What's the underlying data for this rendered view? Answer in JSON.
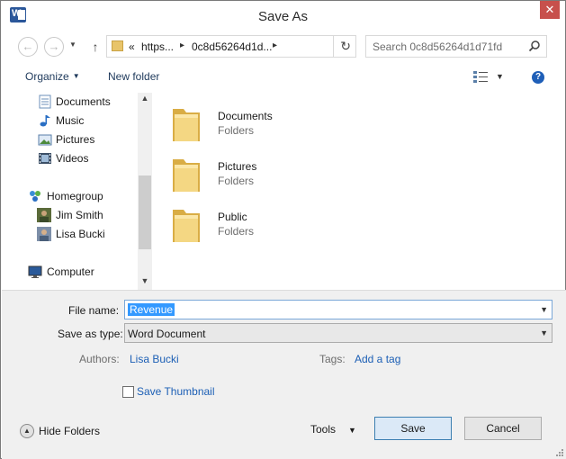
{
  "window": {
    "title": "Save As",
    "app_icon": "word-icon",
    "close_label": "✕"
  },
  "address_bar": {
    "back_icon": "back-arrow-icon",
    "forward_icon": "forward-arrow-icon",
    "up_icon": "up-arrow-icon",
    "overflow": "«",
    "segments": [
      "https...",
      "0c8d56264d1d..."
    ],
    "refresh_icon": "refresh-icon"
  },
  "search": {
    "placeholder": "Search 0c8d56264d1d71fd"
  },
  "toolbar": {
    "organize_label": "Organize",
    "new_folder_label": "New folder",
    "view_icon": "view-options-icon",
    "help_icon": "help-icon",
    "help_label": "?"
  },
  "nav_pane": {
    "items": [
      {
        "label": "Documents",
        "icon": "documents-icon"
      },
      {
        "label": "Music",
        "icon": "music-icon"
      },
      {
        "label": "Pictures",
        "icon": "pictures-icon"
      },
      {
        "label": "Videos",
        "icon": "videos-icon"
      },
      {
        "label": "Homegroup",
        "icon": "homegroup-icon"
      },
      {
        "label": "Jim Smith",
        "icon": "user-avatar-icon"
      },
      {
        "label": "Lisa Bucki",
        "icon": "user-avatar-icon"
      },
      {
        "label": "Computer",
        "icon": "computer-icon"
      }
    ]
  },
  "files": [
    {
      "name": "Documents",
      "type": "Folders"
    },
    {
      "name": "Pictures",
      "type": "Folders"
    },
    {
      "name": "Public",
      "type": "Folders"
    }
  ],
  "form": {
    "file_name_label": "File name:",
    "file_name_value": "Revenue",
    "save_as_type_label": "Save as type:",
    "save_as_type_value": "Word Document",
    "authors_label": "Authors:",
    "authors_value": "Lisa Bucki",
    "tags_label": "Tags:",
    "tags_value": "Add a tag",
    "save_thumbnail_label": "Save Thumbnail",
    "save_thumbnail_checked": false
  },
  "footer": {
    "hide_folders_label": "Hide Folders",
    "tools_label": "Tools",
    "save_label": "Save",
    "cancel_label": "Cancel"
  },
  "colors": {
    "link": "#1c5fb5",
    "selection": "#3399ff",
    "close_button": "#c7504c",
    "folder": "#e8c46a"
  }
}
